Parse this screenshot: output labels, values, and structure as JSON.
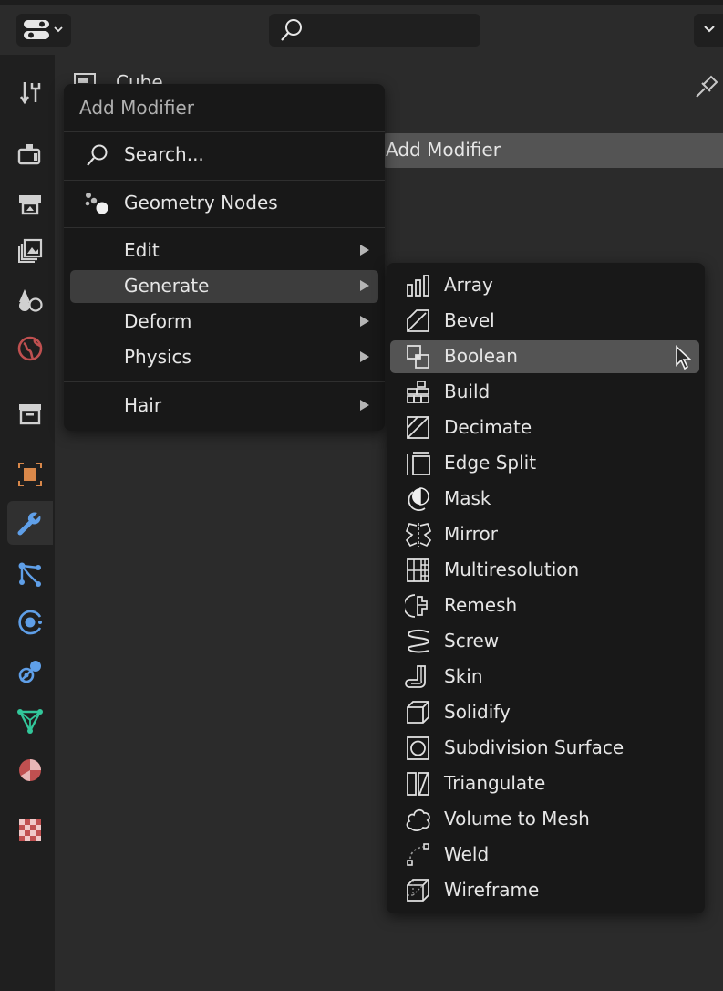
{
  "header": {
    "object_name": "Cube",
    "add_modifier_bar": "Add Modifier"
  },
  "tabs": [
    {
      "name": "tool-tab-icon"
    },
    {
      "name": "render-tab-icon"
    },
    {
      "name": "output-tab-icon"
    },
    {
      "name": "view-layer-tab-icon"
    },
    {
      "name": "scene-tab-icon"
    },
    {
      "name": "world-tab-icon"
    },
    {
      "name": "collection-tab-icon"
    },
    {
      "name": "object-tab-icon"
    },
    {
      "name": "modifier-tab-icon",
      "active": true
    },
    {
      "name": "particles-tab-icon"
    },
    {
      "name": "physics-tab-icon"
    },
    {
      "name": "constraints-tab-icon"
    },
    {
      "name": "data-tab-icon"
    },
    {
      "name": "material-tab-icon"
    },
    {
      "name": "texture-tab-icon"
    }
  ],
  "add_menu": {
    "title": "Add Modifier",
    "search": "Search...",
    "geometry_nodes": "Geometry Nodes",
    "categories": [
      "Edit",
      "Generate",
      "Deform",
      "Physics"
    ],
    "hair": "Hair",
    "highlighted": "Generate"
  },
  "generate_menu": {
    "items": [
      {
        "label": "Array",
        "icon": "array-icon"
      },
      {
        "label": "Bevel",
        "icon": "bevel-icon"
      },
      {
        "label": "Boolean",
        "icon": "boolean-icon"
      },
      {
        "label": "Build",
        "icon": "build-icon"
      },
      {
        "label": "Decimate",
        "icon": "decimate-icon"
      },
      {
        "label": "Edge Split",
        "icon": "edge-split-icon"
      },
      {
        "label": "Mask",
        "icon": "mask-icon"
      },
      {
        "label": "Mirror",
        "icon": "mirror-icon"
      },
      {
        "label": "Multiresolution",
        "icon": "multiresolution-icon"
      },
      {
        "label": "Remesh",
        "icon": "remesh-icon"
      },
      {
        "label": "Screw",
        "icon": "screw-icon"
      },
      {
        "label": "Skin",
        "icon": "skin-icon"
      },
      {
        "label": "Solidify",
        "icon": "solidify-icon"
      },
      {
        "label": "Subdivision Surface",
        "icon": "subdivision-surface-icon"
      },
      {
        "label": "Triangulate",
        "icon": "triangulate-icon"
      },
      {
        "label": "Volume to Mesh",
        "icon": "volume-to-mesh-icon"
      },
      {
        "label": "Weld",
        "icon": "weld-icon"
      },
      {
        "label": "Wireframe",
        "icon": "wireframe-icon"
      }
    ],
    "highlighted": "Boolean"
  }
}
